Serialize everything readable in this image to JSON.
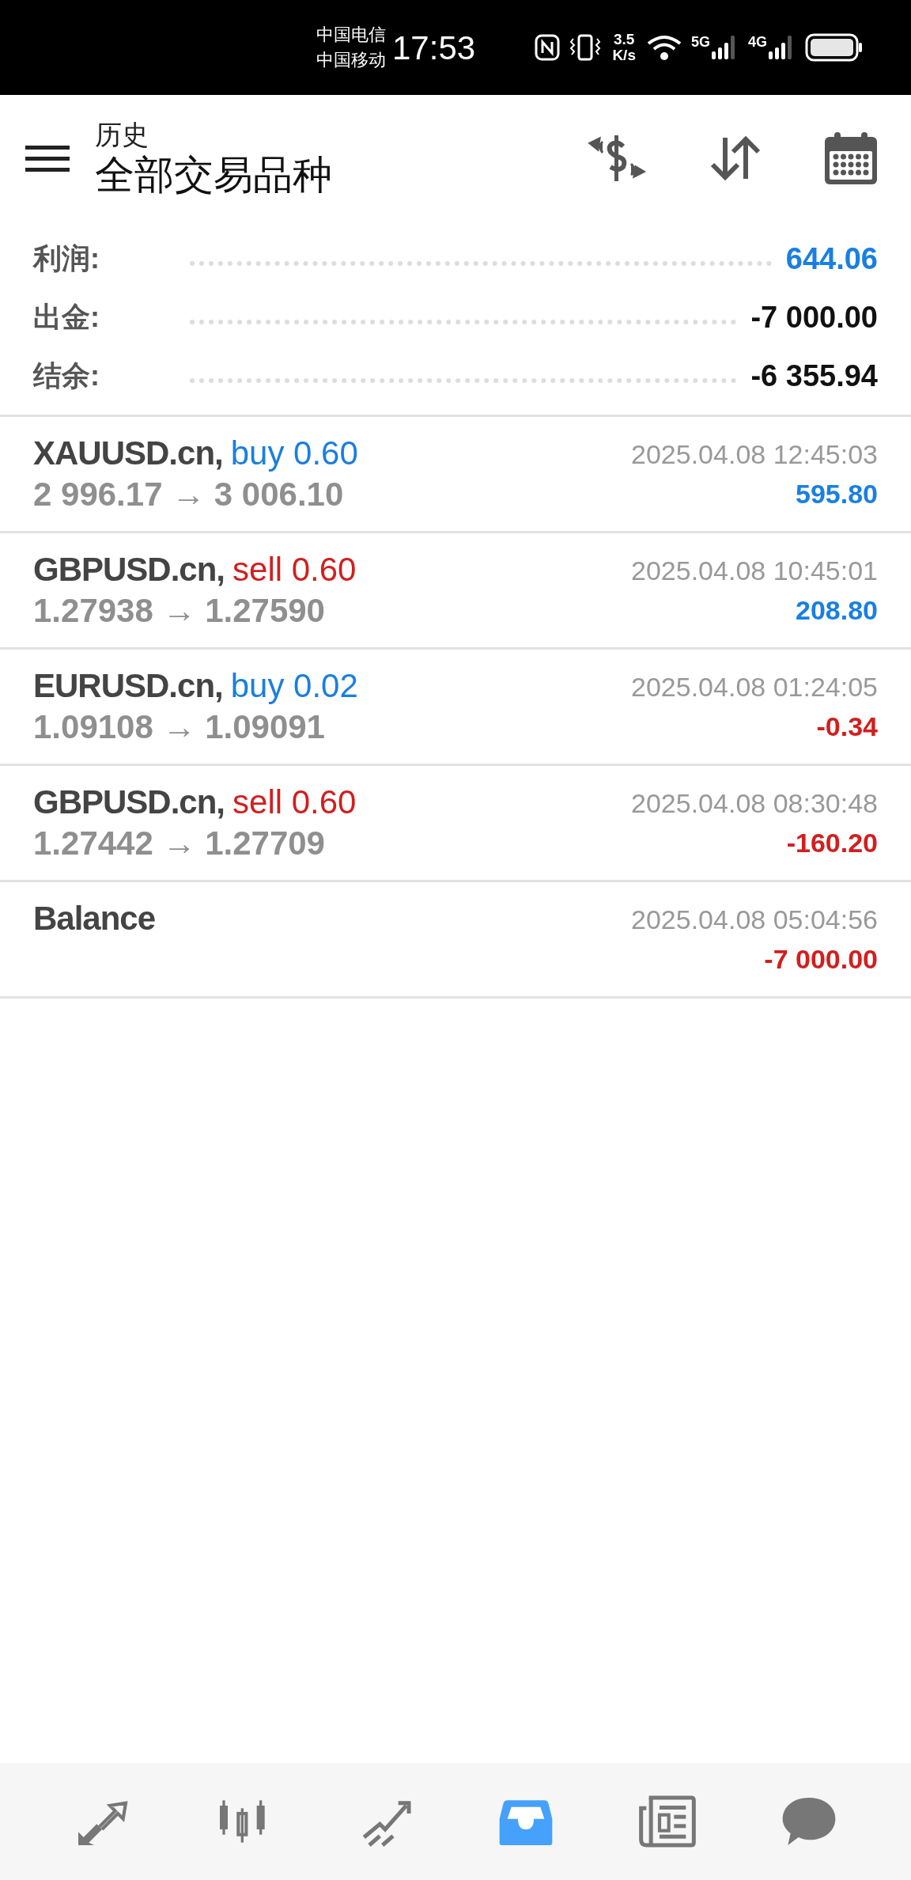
{
  "status_bar": {
    "carriers": [
      "中国电信",
      "中国移动"
    ],
    "time": "17:53",
    "speed_value": "3.5",
    "speed_unit": "K/s",
    "networks": [
      "5G",
      "4G"
    ]
  },
  "header": {
    "subtitle": "历史",
    "title": "全部交易品种"
  },
  "summary": [
    {
      "label": "利润:",
      "value": "644.06",
      "kind": "positive"
    },
    {
      "label": "出金:",
      "value": "-7 000.00",
      "kind": "plain"
    },
    {
      "label": "结余:",
      "value": "-6 355.94",
      "kind": "plain"
    }
  ],
  "deals": [
    {
      "kind": "trade",
      "symbol": "XAUUSD.cn,",
      "side": "buy",
      "volume": "0.60",
      "prices": "2 996.17 → 3 006.10",
      "time": "2025.04.08 12:45:03",
      "profit": "595.80",
      "color": "#1a7fe0"
    },
    {
      "kind": "trade",
      "symbol": "GBPUSD.cn,",
      "side": "sell",
      "volume": "0.60",
      "prices": "1.27938 → 1.27590",
      "time": "2025.04.08 10:45:01",
      "profit": "208.80",
      "color": "#1a7fe0"
    },
    {
      "kind": "trade",
      "symbol": "EURUSD.cn,",
      "side": "buy",
      "volume": "0.02",
      "prices": "1.09108 → 1.09091",
      "time": "2025.04.08 01:24:05",
      "profit": "-0.34",
      "color": "#d11f1f"
    },
    {
      "kind": "trade",
      "symbol": "GBPUSD.cn,",
      "side": "sell",
      "volume": "0.60",
      "prices": "1.27442 → 1.27709",
      "time": "2025.04.08 08:30:48",
      "profit": "-160.20",
      "color": "#d11f1f"
    },
    {
      "kind": "balance",
      "symbol": "Balance",
      "time": "2025.04.08 05:04:56",
      "profit": "-7 000.00",
      "color": "#d11f1f"
    }
  ],
  "bottom_nav": [
    {
      "kind": "quotes",
      "selected": false
    },
    {
      "kind": "chart",
      "selected": false
    },
    {
      "kind": "trade",
      "selected": false
    },
    {
      "kind": "history",
      "selected": true
    },
    {
      "kind": "news",
      "selected": false
    },
    {
      "kind": "chat",
      "selected": false
    }
  ]
}
